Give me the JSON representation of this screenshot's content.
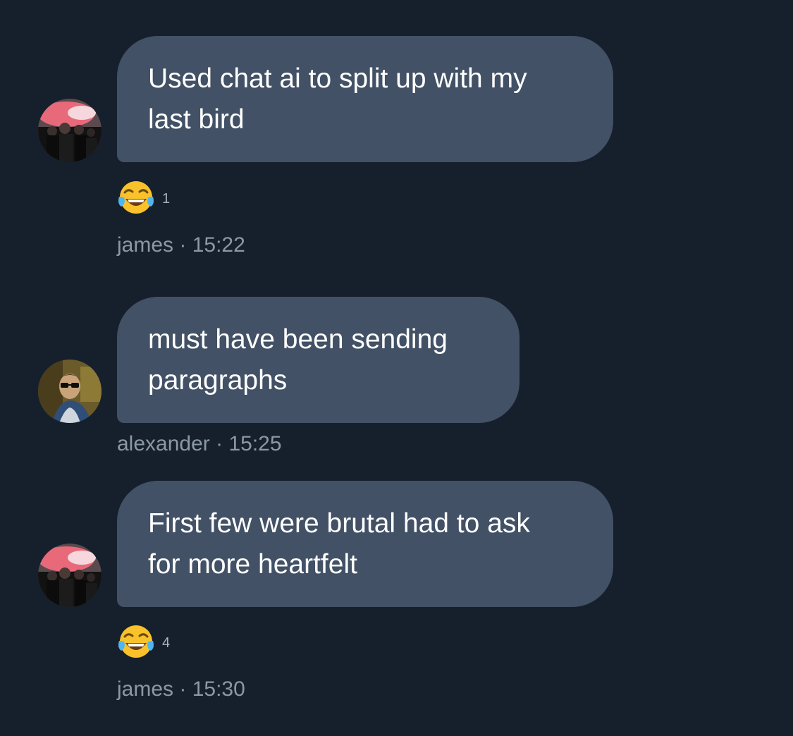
{
  "messages": [
    {
      "avatar_icon": "group-photo-avatar",
      "lines": [
        "Used chat ai to split up with my",
        "last bird"
      ],
      "reaction": {
        "icon": "tears-of-joy-emoji",
        "count": "1"
      },
      "author": "james",
      "separator": "·",
      "time": "15:22"
    },
    {
      "avatar_icon": "sunglasses-portrait-avatar",
      "lines": [
        "must have been sending",
        "paragraphs"
      ],
      "author": "alexander",
      "separator": "·",
      "time": "15:25"
    },
    {
      "avatar_icon": "group-photo-avatar",
      "lines": [
        "First few were brutal had to ask",
        "for more heartfelt"
      ],
      "reaction": {
        "icon": "tears-of-joy-emoji",
        "count": "4"
      },
      "author": "james",
      "separator": "·",
      "time": "15:30"
    }
  ],
  "colors": {
    "background": "#16202c",
    "bubble": "#425165",
    "text": "#ffffff",
    "meta_text": "#8b98a5"
  }
}
